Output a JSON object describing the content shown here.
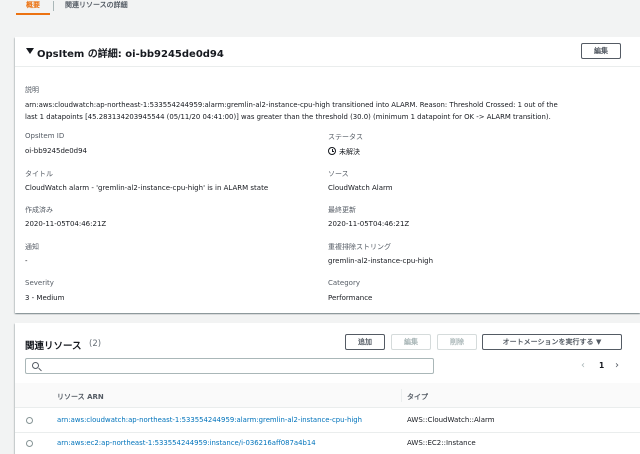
{
  "tabs": [
    {
      "label": "概要",
      "active": true
    },
    {
      "label": "関連リソースの詳細",
      "active": false
    }
  ],
  "details": {
    "title": "OpsItem の詳細: oi-bb9245de0d94",
    "edit_label": "編集",
    "description_label": "説明",
    "description_value": "arn:aws:cloudwatch:ap-northeast-1:533554244959:alarm:gremlin-al2-instance-cpu-high transitioned into ALARM. Reason: Threshold Crossed: 1 out of the last 1 datapoints [45.283134203945544 (05/11/20 04:41:00)] was greater than the threshold (30.0) (minimum 1 datapoint for OK -> ALARM transition).",
    "opsitem_id_label": "OpsItem ID",
    "opsitem_id_value": "oi-bb9245de0d94",
    "status_label": "ステータス",
    "status_value": "未解決",
    "title_label": "タイトル",
    "title_value": "CloudWatch alarm - 'gremlin-al2-instance-cpu-high' is in ALARM state",
    "source_label": "ソース",
    "source_value": "CloudWatch Alarm",
    "created_label": "作成済み",
    "created_value": "2020-11-05T04:46:21Z",
    "updated_label": "最終更新",
    "updated_value": "2020-11-05T04:46:21Z",
    "notification_label": "通知",
    "notification_value": "-",
    "dedup_label": "重複排除ストリング",
    "dedup_value": "gremlin-al2-instance-cpu-high",
    "severity_label": "Severity",
    "severity_value": "3 - Medium",
    "category_label": "Category",
    "category_value": "Performance"
  },
  "related": {
    "title": "関連リソース",
    "count": "(2)",
    "add_label": "追加",
    "edit_label": "編集",
    "delete_label": "削除",
    "automation_label": "オートメーションを実行する ▼",
    "search_placeholder": "",
    "page": "1",
    "prev_icon": "‹",
    "next_icon": "›",
    "columns": [
      "リソース ARN",
      "タイプ"
    ],
    "rows": [
      {
        "arn": "arn:aws:cloudwatch:ap-northeast-1:533554244959:alarm:gremlin-al2-instance-cpu-high",
        "type": "AWS::CloudWatch::Alarm"
      },
      {
        "arn": "arn:aws:ec2:ap-northeast-1:533554244959:instance/i-036216aff087a4b14",
        "type": "AWS::EC2::Instance"
      }
    ]
  },
  "colors": {
    "accent": "#ec7211",
    "link": "#0073bb",
    "background": "#f2f3f3"
  },
  "icons": {
    "collapse": "caret-down-icon",
    "status": "clock-icon",
    "search": "search-icon"
  }
}
